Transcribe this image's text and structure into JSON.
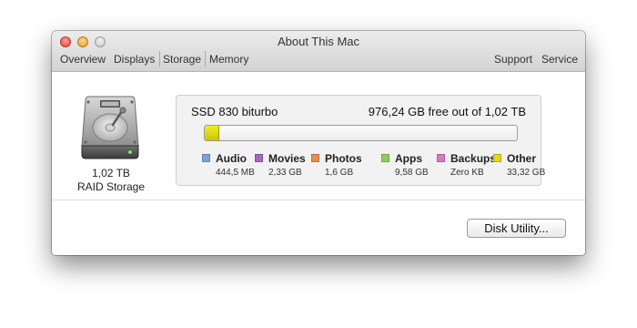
{
  "window": {
    "title": "About This Mac",
    "tabs_left": [
      "Overview",
      "Displays",
      "Storage",
      "Memory"
    ],
    "tabs_right": [
      "Support",
      "Service"
    ],
    "selected_tab": "Storage"
  },
  "disk": {
    "size": "1,02 TB",
    "type": "RAID Storage",
    "icon": "hard-drive-icon"
  },
  "storage": {
    "disk_name": "SSD 830 biturbo",
    "free_text": "976,24 GB free out of 1,02 TB",
    "used_fraction": 0.044,
    "categories": [
      {
        "label": "Audio",
        "value": "444,5 MB",
        "color": "#7ea1d9"
      },
      {
        "label": "Movies",
        "value": "2,33 GB",
        "color": "#a865c6"
      },
      {
        "label": "Photos",
        "value": "1,6 GB",
        "color": "#ec8b54"
      },
      {
        "label": "Apps",
        "value": "9,58 GB",
        "color": "#8ccd5a"
      },
      {
        "label": "Backups",
        "value": "Zero KB",
        "color": "#d978c6"
      },
      {
        "label": "Other",
        "value": "33,32 GB",
        "color": "#e6d51b"
      }
    ]
  },
  "actions": {
    "disk_utility": "Disk Utility..."
  }
}
